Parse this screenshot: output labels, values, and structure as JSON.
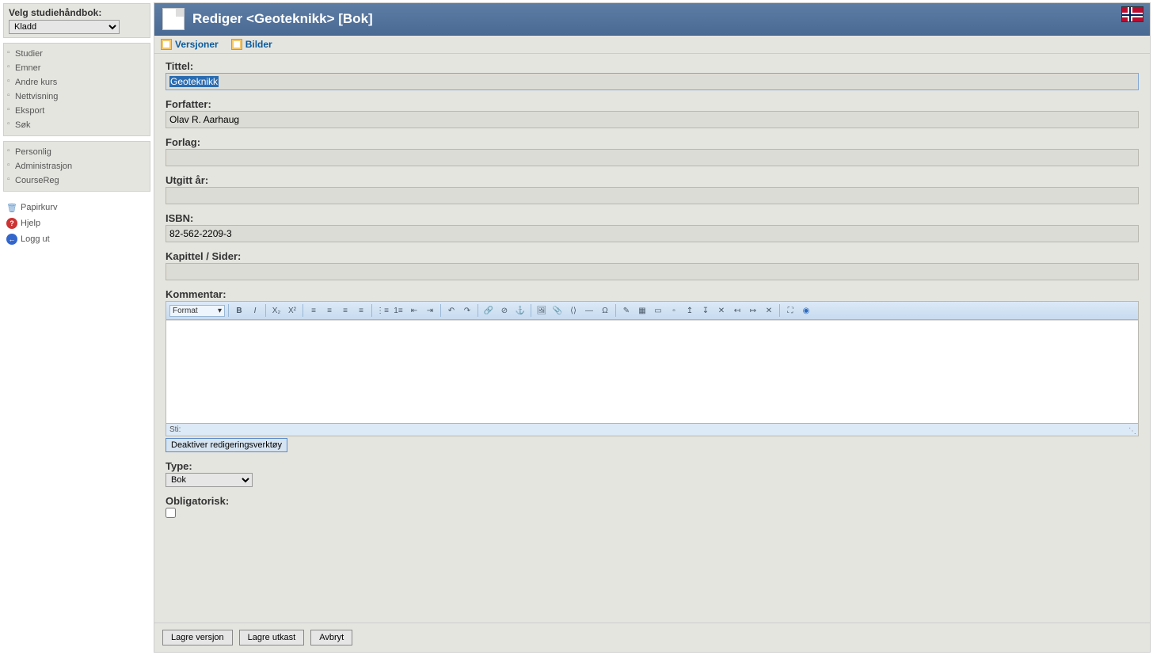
{
  "sidebar": {
    "select_label": "Velg studiehåndbok:",
    "select_value": "Kladd",
    "nav1": [
      {
        "label": "Studier"
      },
      {
        "label": "Emner"
      },
      {
        "label": "Andre kurs"
      },
      {
        "label": "Nettvisning"
      },
      {
        "label": "Eksport"
      },
      {
        "label": "Søk"
      }
    ],
    "nav2": [
      {
        "label": "Personlig"
      },
      {
        "label": "Administrasjon"
      },
      {
        "label": "CourseReg"
      }
    ],
    "util": {
      "trash": "Papirkurv",
      "help": "Hjelp",
      "logout": "Logg ut"
    }
  },
  "header": {
    "title": "Rediger <Geoteknikk> [Bok]"
  },
  "tabs": {
    "versions": "Versjoner",
    "images": "Bilder"
  },
  "form": {
    "title_label": "Tittel:",
    "title_value": "Geoteknikk",
    "author_label": "Forfatter:",
    "author_value": "Olav R. Aarhaug",
    "publisher_label": "Forlag:",
    "publisher_value": "",
    "year_label": "Utgitt år:",
    "year_value": "",
    "isbn_label": "ISBN:",
    "isbn_value": "82-562-2209-3",
    "chapter_label": "Kapittel / Sider:",
    "chapter_value": "",
    "comment_label": "Kommentar:",
    "editor_format": "Format",
    "editor_status": "Sti:",
    "deactivate_btn": "Deaktiver redigeringsverktøy",
    "type_label": "Type:",
    "type_value": "Bok",
    "mandatory_label": "Obligatorisk:"
  },
  "footer": {
    "save_version": "Lagre versjon",
    "save_draft": "Lagre utkast",
    "cancel": "Avbryt"
  }
}
